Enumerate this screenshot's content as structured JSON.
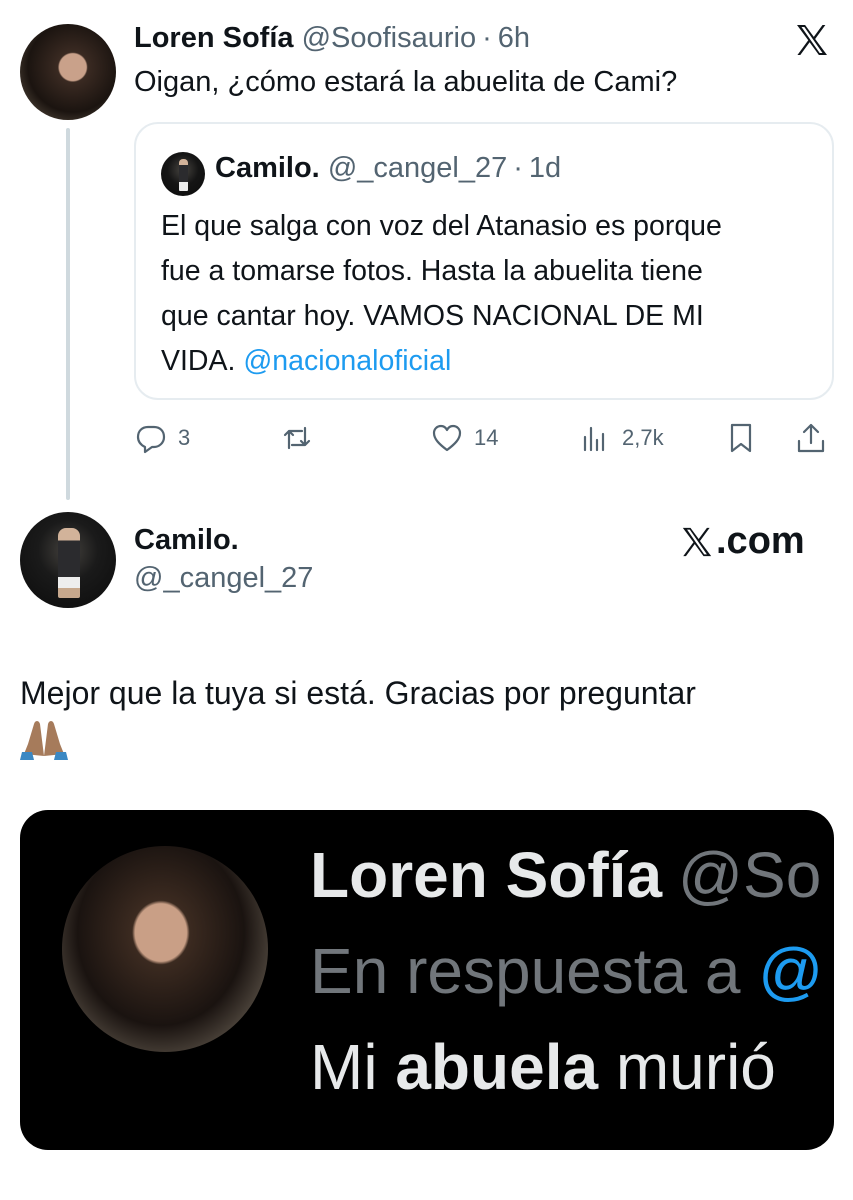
{
  "tweet": {
    "author_name": "Loren Sofía",
    "author_handle": "@Soofisaurio",
    "separator": "·",
    "time": "6h",
    "text": "Oigan, ¿cómo estará la abuelita de Cami?"
  },
  "quote": {
    "author_name": "Camilo.",
    "author_handle": "@_cangel_27",
    "separator": "·",
    "time": "1d",
    "text_lines": [
      "El que salga con voz del Atanasio es porque",
      "fue a tomarse fotos. Hasta la abuelita tiene",
      "que cantar hoy. VAMOS NACIONAL DE MI"
    ],
    "text_last_prefix": "VIDA. ",
    "mention": "@nacionaloficial"
  },
  "actions": {
    "replies": "3",
    "retweets": "",
    "likes": "14",
    "views": "2,7k"
  },
  "reply": {
    "author_name": "Camilo.",
    "author_handle": "@_cangel_27",
    "brand": ".com",
    "text": "Mejor que la tuya si está. Gracias por preguntar"
  },
  "embedded_image": {
    "name": "Loren Sofía",
    "handle_partial": "@So",
    "reply_prefix": "En respuesta a ",
    "reply_mention": "@",
    "text_prefix": "Mi ",
    "text_bold": "abuela",
    "text_suffix": " murió"
  },
  "icons": {
    "logo": "x-logo-icon",
    "reply": "comment-icon",
    "retweet": "retweet-icon",
    "like": "heart-icon",
    "views": "bar-chart-icon",
    "bookmark": "bookmark-icon",
    "share": "share-icon",
    "emoji": "folded-hands-emoji"
  },
  "colors": {
    "link": "#1d9bf0",
    "muted": "#536471",
    "text": "#0f1419"
  }
}
